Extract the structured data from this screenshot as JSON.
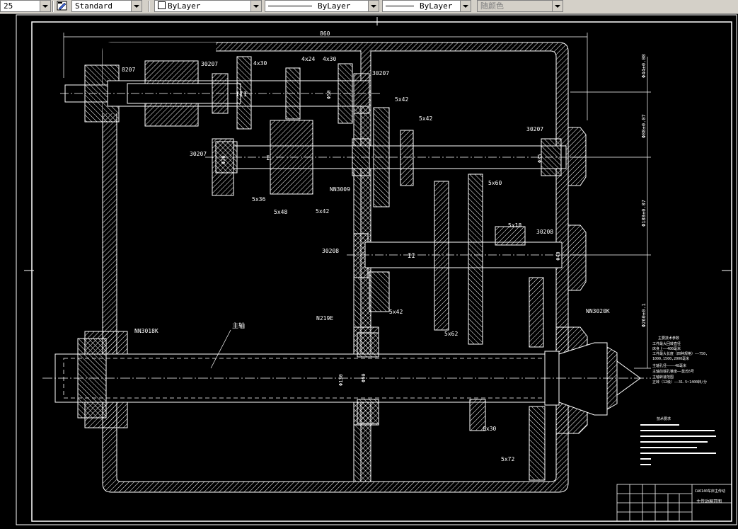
{
  "toolbar": {
    "scale_value": "25",
    "text_style": "Standard",
    "layer": "ByLayer",
    "linetype": "ByLayer",
    "lineweight": "ByLayer",
    "color": "随颜色"
  },
  "drawing": {
    "dim_overall_width": "860",
    "dims_right": [
      "Φ44±0.08",
      "Φ88±0.07",
      "Φ188±0.07",
      "Φ260±0.1"
    ],
    "bearing_labels": [
      "8207",
      "30207",
      "30207",
      "30207",
      "30208",
      "30208",
      "30207",
      "NN3009",
      "N219E",
      "NN3018K",
      "NN3020K"
    ],
    "spline_labels": [
      "4x30",
      "4x24",
      "4x30",
      "5x42",
      "5x42",
      "5x36",
      "5x48",
      "5x42",
      "5x60",
      "5x18",
      "5x42",
      "5x62",
      "6x30",
      "5x72"
    ],
    "shaft_labels": [
      "I",
      "II",
      "III"
    ],
    "main_shaft_label": "主轴",
    "bore_labels": [
      "Φ130",
      "Φ90",
      "Φ50",
      "Φ40",
      "Φ35",
      "Φ30"
    ],
    "tech_notes": [
      "主要技术参数",
      "工件最大回转直径",
      "  床身上——400毫米",
      "工件最大长度（四种规格）——750,",
      "  1000,1500,2000毫米",
      "主轴孔径————48毫米",
      "主轴前端孔锥度——莫氏6号",
      "主轴转速范围",
      "  正转（12级）——31.5~1400转/分"
    ],
    "req_title": "技术要求",
    "title_block_name": "主传动展开图",
    "title_block_school": "CA6140车床主传动"
  },
  "colors": {
    "background": "#000000",
    "lines": "#ffffff",
    "toolbar": "#d4d0c8"
  }
}
